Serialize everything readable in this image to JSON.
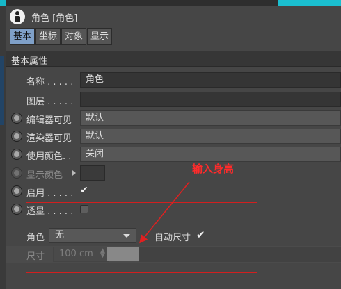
{
  "header": {
    "title": "角色 [角色]",
    "icon": "character-object-icon"
  },
  "tabs": [
    "基本",
    "坐标",
    "对象",
    "显示"
  ],
  "active_tab": "基本",
  "section_title": "基本属性",
  "rows": {
    "name": {
      "label": "名称 . . . . .",
      "value": "角色"
    },
    "layer": {
      "label": "图层 . . . . .",
      "value": ""
    },
    "editor_visible": {
      "label": "编辑器可见",
      "value": "默认"
    },
    "render_visible": {
      "label": "渲染器可见",
      "value": "默认"
    },
    "use_color": {
      "label": "使用颜色. .",
      "value": "关闭"
    },
    "display_color": {
      "label": "显示颜色"
    },
    "enabled": {
      "label": "启用 . . . . .",
      "check": "✔"
    },
    "xray": {
      "label": "透显 . . . . ."
    }
  },
  "character": {
    "role_label": "角色",
    "role_value": "无",
    "auto_size_label": "自动尺寸",
    "auto_size_check": "✔",
    "size_label": "尺寸",
    "size_value": "100 cm"
  },
  "annotation": {
    "text": "输入身高",
    "color": "#ff2b2b"
  },
  "colors": {
    "accent_tab": "#7fa0c8",
    "panel": "#464646",
    "highlight": "#d21f1f"
  }
}
